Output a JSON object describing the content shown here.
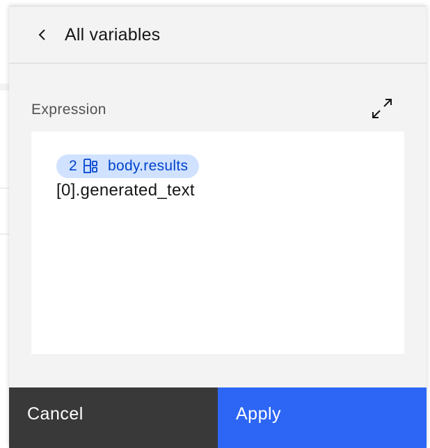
{
  "header": {
    "title": "All variables",
    "back_icon": "chevron-left-icon"
  },
  "expression": {
    "label": "Expression",
    "expand_icon": "maximize-icon",
    "token": {
      "count": "2",
      "icon": "data-structure-icon",
      "text": "body.results"
    },
    "rest": "[0].generated_text"
  },
  "footer": {
    "cancel_label": "Cancel",
    "apply_label": "Apply"
  },
  "colors": {
    "panel_bg": "#f3f3f3",
    "token_bg": "#d0e2ff",
    "token_fg": "#0043ce",
    "cancel_bg": "#393939",
    "apply_bg": "#2d66f4"
  }
}
